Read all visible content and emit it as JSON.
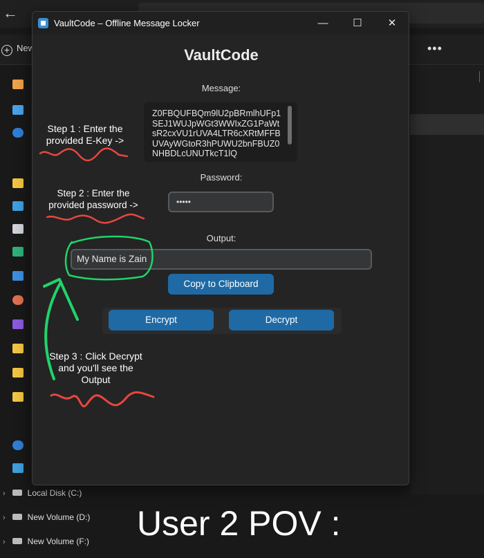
{
  "explorer": {
    "new_label": "New",
    "drives": [
      "Local Disk (C:)",
      "New Volume (D:)",
      "New Volume (F:)"
    ]
  },
  "app": {
    "window_title": "VaultCode – Offline Message Locker",
    "heading": "VaultCode",
    "message_label": "Message:",
    "message_value": "Z0FBQUFBQm9lU2pBRmlhUFp1SEJ1WUJpWGt3WWIxZG1PaWtsR2cxVU1rUVA4LTR6cXRtMFFBUVAyWGtoR3hPUWU2bnFBUZ0NHBDLcUNUTkcT1lQ",
    "password_label": "Password:",
    "password_value": "•••••",
    "output_label": "Output:",
    "output_value": "My Name is Zain",
    "copy_label": "Copy to Clipboard",
    "encrypt_label": "Encrypt",
    "decrypt_label": "Decrypt",
    "accent_color": "#1f6aa5"
  },
  "annotations": {
    "step1": "Step 1 : Enter the provided E-Key ->",
    "step2": "Step 2 : Enter the provided password ->",
    "step3": "Step 3 : Click Decrypt and you'll see the Output",
    "caption": "User 2 POV :",
    "underline_color": "#e8473f",
    "highlight_color": "#1fd46a"
  }
}
